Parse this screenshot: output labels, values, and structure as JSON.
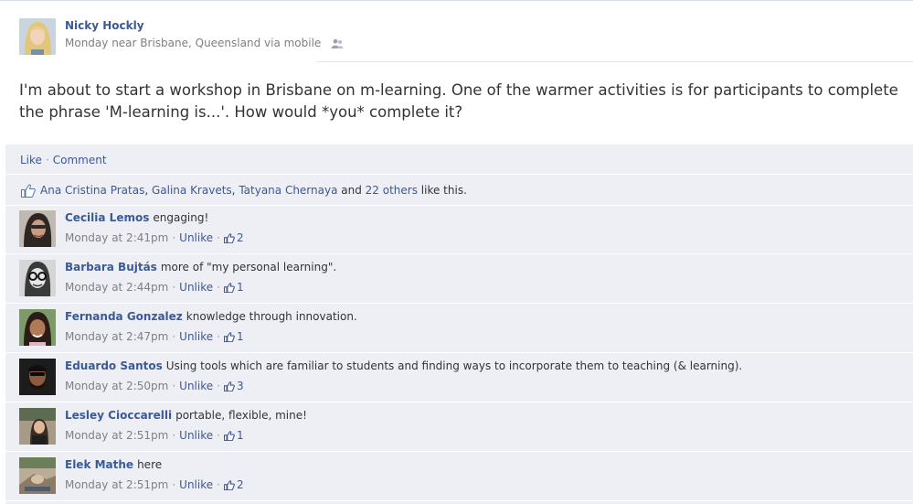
{
  "post": {
    "author": "Nicky Hockly",
    "meta": "Monday near Brisbane, Queensland via mobile",
    "body": "I'm about to start a workshop in Brisbane on m-learning. One of the warmer activities is for participants to complete the phrase 'M-learning is...'. How would *you* complete it?"
  },
  "actions": {
    "like": "Like",
    "separator": "·",
    "comment": "Comment"
  },
  "likes": {
    "people": [
      "Ana Cristina Pratas",
      "Galina Kravets",
      "Tatyana Chernaya"
    ],
    "sep1": ", ",
    "sep2": ", ",
    "and": " and ",
    "others": "22 others",
    "suffix": " like this."
  },
  "comments": [
    {
      "name": "Cecilia Lemos",
      "text": "engaging!",
      "time": "Monday at 2:41pm",
      "unlike": "Unlike",
      "likes": "2"
    },
    {
      "name": "Barbara Bujtás",
      "text": "more of \"my personal learning\".",
      "time": "Monday at 2:44pm",
      "unlike": "Unlike",
      "likes": "1"
    },
    {
      "name": "Fernanda Gonzalez",
      "text": "knowledge through innovation.",
      "time": "Monday at 2:47pm",
      "unlike": "Unlike",
      "likes": "1"
    },
    {
      "name": "Eduardo Santos",
      "text": "Using tools which are familiar to students and finding ways to incorporate them to teaching (& learning).",
      "time": "Monday at 2:50pm",
      "unlike": "Unlike",
      "likes": "3"
    },
    {
      "name": "Lesley Cioccarelli",
      "text": "portable, flexible, mine!",
      "time": "Monday at 2:51pm",
      "unlike": "Unlike",
      "likes": "1"
    },
    {
      "name": "Elek Mathe",
      "text": "here",
      "time": "Monday at 2:51pm",
      "unlike": "Unlike",
      "likes": "2"
    }
  ],
  "dot": "·",
  "colors": {
    "link": "#3b5998",
    "feedback_bg": "#edeff4",
    "meta_text": "#7f7f7f"
  },
  "icons": {
    "audience": "friends-icon",
    "like": "thumbs-up-icon"
  }
}
